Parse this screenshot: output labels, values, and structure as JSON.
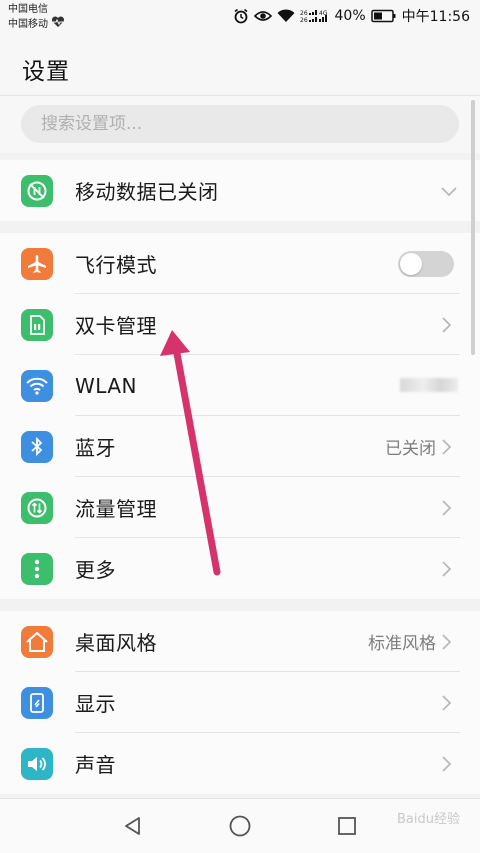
{
  "status_bar": {
    "carrier_1": "中国电信",
    "carrier_2": "中国移动",
    "battery": "40%",
    "time": "中午11:56",
    "signal_label_1": "26",
    "signal_label_2": "26",
    "network": "4G",
    "icons": [
      "heartbeat-icon",
      "alarm-icon",
      "eye-icon",
      "wifi-icon",
      "signal-icon",
      "battery-icon"
    ]
  },
  "header": {
    "title": "设置"
  },
  "search": {
    "placeholder": "搜索设置项..."
  },
  "groups": [
    {
      "items": [
        {
          "label": "移动数据已关闭",
          "icon": "mobile-data-off-icon",
          "color": "#3dbe6d",
          "control": "chevron-down"
        }
      ]
    },
    {
      "items": [
        {
          "label": "飞行模式",
          "icon": "airplane-icon",
          "color": "#f07b3a",
          "control": "toggle",
          "toggle_on": false
        },
        {
          "label": "双卡管理",
          "icon": "sim-card-icon",
          "color": "#3dbe6d",
          "control": "chevron"
        },
        {
          "label": "WLAN",
          "icon": "wifi-icon",
          "color": "#3f8fe0",
          "control": "blurred"
        },
        {
          "label": "蓝牙",
          "icon": "bluetooth-icon",
          "color": "#3f8fe0",
          "value": "已关闭",
          "control": "chevron"
        },
        {
          "label": "流量管理",
          "icon": "traffic-icon",
          "color": "#3dbe6d",
          "control": "chevron"
        },
        {
          "label": "更多",
          "icon": "more-icon",
          "color": "#3dbe6d",
          "control": "chevron"
        }
      ]
    },
    {
      "items": [
        {
          "label": "桌面风格",
          "icon": "home-style-icon",
          "color": "#f07b3a",
          "value": "标准风格",
          "control": "chevron"
        },
        {
          "label": "显示",
          "icon": "display-icon",
          "color": "#3f8fe0",
          "control": "chevron"
        },
        {
          "label": "声音",
          "icon": "sound-icon",
          "color": "#2fb6c6",
          "control": "chevron"
        }
      ]
    }
  ],
  "nav": {
    "buttons": [
      "back-icon",
      "home-icon",
      "recents-icon"
    ]
  },
  "annotation": {
    "arrow_color": "#d6336c"
  },
  "watermark": "Baidu经验"
}
